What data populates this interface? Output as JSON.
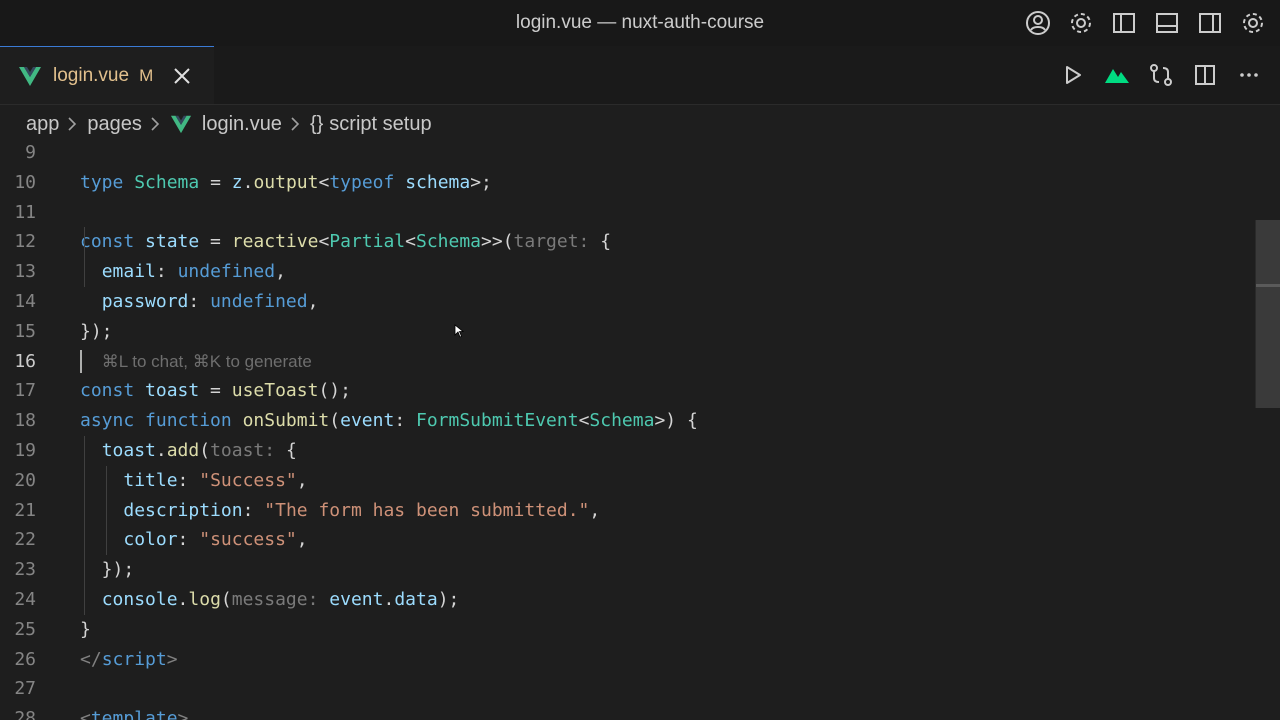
{
  "window": {
    "title": "login.vue — nuxt-auth-course"
  },
  "title_actions": [
    {
      "name": "account-icon"
    },
    {
      "name": "settings-icon"
    },
    {
      "name": "toggle-primary-sidebar-icon"
    },
    {
      "name": "toggle-panel-icon"
    },
    {
      "name": "toggle-secondary-sidebar-icon"
    },
    {
      "name": "manage-gear-icon"
    }
  ],
  "tab": {
    "name": "login.vue",
    "modified": "M"
  },
  "editor_actions": [
    {
      "name": "run-icon"
    },
    {
      "name": "nuxt-icon"
    },
    {
      "name": "source-control-compare-icon"
    },
    {
      "name": "split-editor-icon"
    },
    {
      "name": "more-actions-icon"
    }
  ],
  "breadcrumb": {
    "items": [
      "app",
      "pages",
      "login.vue",
      "script setup"
    ],
    "braces": "{}"
  },
  "colors": {
    "accent": "#3b7bd6",
    "modified": "#e2c08d",
    "vue_green": "#41b883"
  },
  "code": {
    "active_line": 16,
    "lines": [
      {
        "n": "9",
        "tokens": []
      },
      {
        "n": "10",
        "tokens": [
          [
            "kw",
            "type"
          ],
          [
            "p",
            " "
          ],
          [
            "ty",
            "Schema"
          ],
          [
            "p",
            " = "
          ],
          [
            "var",
            "z"
          ],
          [
            "p",
            "."
          ],
          [
            "fn",
            "output"
          ],
          [
            "p",
            "<"
          ],
          [
            "kw",
            "typeof"
          ],
          [
            "p",
            " "
          ],
          [
            "var",
            "schema"
          ],
          [
            "p",
            ">;"
          ]
        ]
      },
      {
        "n": "11",
        "tokens": []
      },
      {
        "n": "12",
        "tokens": [
          [
            "kw",
            "const"
          ],
          [
            "p",
            " "
          ],
          [
            "var",
            "state"
          ],
          [
            "p",
            " = "
          ],
          [
            "fn",
            "reactive"
          ],
          [
            "p",
            "<"
          ],
          [
            "ty",
            "Partial"
          ],
          [
            "p",
            "<"
          ],
          [
            "ty",
            "Schema"
          ],
          [
            "p",
            ">>("
          ],
          [
            "hint",
            "target:"
          ],
          [
            "p",
            " {"
          ]
        ]
      },
      {
        "n": "13",
        "tokens": [
          [
            "p",
            "  "
          ],
          [
            "var",
            "email"
          ],
          [
            "p",
            ": "
          ],
          [
            "kw",
            "undefined"
          ],
          [
            "p",
            ","
          ]
        ]
      },
      {
        "n": "14",
        "tokens": [
          [
            "p",
            "  "
          ],
          [
            "var",
            "password"
          ],
          [
            "p",
            ": "
          ],
          [
            "kw",
            "undefined"
          ],
          [
            "p",
            ","
          ]
        ]
      },
      {
        "n": "15",
        "tokens": [
          [
            "p",
            "});"
          ]
        ]
      },
      {
        "n": "16",
        "tokens": [
          [
            "p",
            "  "
          ],
          [
            "hint-sm",
            "⌘L to chat, ⌘K to generate"
          ]
        ]
      },
      {
        "n": "17",
        "tokens": [
          [
            "kw",
            "const"
          ],
          [
            "p",
            " "
          ],
          [
            "var",
            "toast"
          ],
          [
            "p",
            " = "
          ],
          [
            "fn",
            "useToast"
          ],
          [
            "p",
            "();"
          ]
        ]
      },
      {
        "n": "18",
        "tokens": [
          [
            "kw",
            "async"
          ],
          [
            "p",
            " "
          ],
          [
            "kw",
            "function"
          ],
          [
            "p",
            " "
          ],
          [
            "fn",
            "onSubmit"
          ],
          [
            "p",
            "("
          ],
          [
            "var",
            "event"
          ],
          [
            "p",
            ": "
          ],
          [
            "ty",
            "FormSubmitEvent"
          ],
          [
            "p",
            "<"
          ],
          [
            "ty",
            "Schema"
          ],
          [
            "p",
            ">) {"
          ]
        ]
      },
      {
        "n": "19",
        "tokens": [
          [
            "p",
            "  "
          ],
          [
            "var",
            "toast"
          ],
          [
            "p",
            "."
          ],
          [
            "fn",
            "add"
          ],
          [
            "p",
            "("
          ],
          [
            "hint",
            "toast:"
          ],
          [
            "p",
            " {"
          ]
        ]
      },
      {
        "n": "20",
        "tokens": [
          [
            "p",
            "    "
          ],
          [
            "var",
            "title"
          ],
          [
            "p",
            ": "
          ],
          [
            "str",
            "\"Success\""
          ],
          [
            "p",
            ","
          ]
        ]
      },
      {
        "n": "21",
        "tokens": [
          [
            "p",
            "    "
          ],
          [
            "var",
            "description"
          ],
          [
            "p",
            ": "
          ],
          [
            "str",
            "\"The form has been submitted.\""
          ],
          [
            "p",
            ","
          ]
        ]
      },
      {
        "n": "22",
        "tokens": [
          [
            "p",
            "    "
          ],
          [
            "var",
            "color"
          ],
          [
            "p",
            ": "
          ],
          [
            "str",
            "\"success\""
          ],
          [
            "p",
            ","
          ]
        ]
      },
      {
        "n": "23",
        "tokens": [
          [
            "p",
            "  });"
          ]
        ]
      },
      {
        "n": "24",
        "tokens": [
          [
            "p",
            "  "
          ],
          [
            "var",
            "console"
          ],
          [
            "p",
            "."
          ],
          [
            "fn",
            "log"
          ],
          [
            "p",
            "("
          ],
          [
            "hint",
            "message:"
          ],
          [
            "p",
            " "
          ],
          [
            "var",
            "event"
          ],
          [
            "p",
            "."
          ],
          [
            "var",
            "data"
          ],
          [
            "p",
            ");"
          ]
        ]
      },
      {
        "n": "25",
        "tokens": [
          [
            "p",
            "}"
          ]
        ]
      },
      {
        "n": "26",
        "tokens": [
          [
            "tag",
            "</"
          ],
          [
            "tagname",
            "script"
          ],
          [
            "tag",
            ">"
          ]
        ]
      },
      {
        "n": "27",
        "tokens": []
      },
      {
        "n": "28",
        "tokens": [
          [
            "tag",
            "<"
          ],
          [
            "tagname",
            "template"
          ],
          [
            "tag",
            ">"
          ]
        ]
      }
    ]
  }
}
